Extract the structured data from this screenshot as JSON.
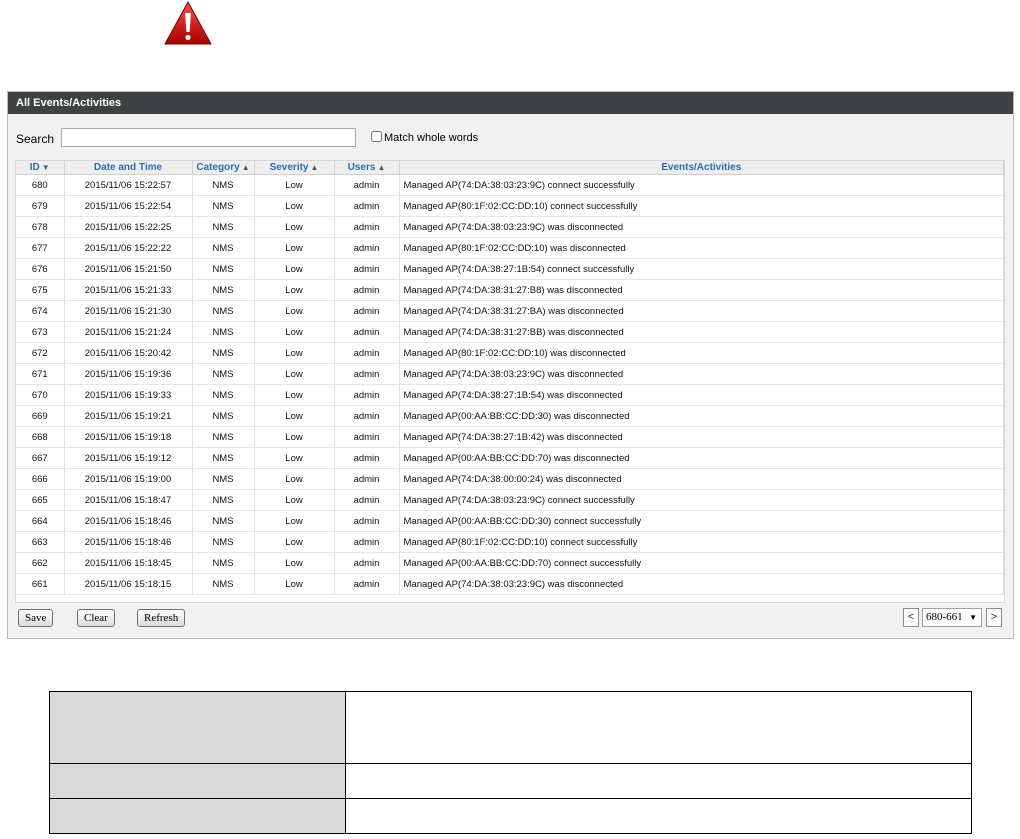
{
  "icons": {
    "warning": "warning-triangle-icon"
  },
  "colors": {
    "header_bg": "#3f4142",
    "link_blue": "#2a6db3",
    "warning_red": "#cc1111"
  },
  "panel": {
    "title": "All Events/Activities",
    "search_label": "Search",
    "search_value": "",
    "match_whole_words_label": "Match whole words",
    "match_whole_words_checked": false
  },
  "grid": {
    "columns": [
      {
        "label": "ID",
        "sort": "down"
      },
      {
        "label": "Date and Time",
        "sort": ""
      },
      {
        "label": "Category",
        "sort": "up"
      },
      {
        "label": "Severity",
        "sort": "up"
      },
      {
        "label": "Users",
        "sort": "up"
      },
      {
        "label": "Events/Activities",
        "sort": ""
      }
    ],
    "rows": [
      {
        "id": "680",
        "dt": "2015/11/06 15:22:57",
        "cat": "NMS",
        "sev": "Low",
        "user": "admin",
        "ev": "Managed AP(74:DA:38:03:23:9C) connect successfully"
      },
      {
        "id": "679",
        "dt": "2015/11/06 15:22:54",
        "cat": "NMS",
        "sev": "Low",
        "user": "admin",
        "ev": "Managed AP(80:1F:02:CC:DD:10) connect successfully"
      },
      {
        "id": "678",
        "dt": "2015/11/06 15:22:25",
        "cat": "NMS",
        "sev": "Low",
        "user": "admin",
        "ev": "Managed AP(74:DA:38:03:23:9C) was disconnected"
      },
      {
        "id": "677",
        "dt": "2015/11/06 15:22:22",
        "cat": "NMS",
        "sev": "Low",
        "user": "admin",
        "ev": "Managed AP(80:1F:02:CC:DD:10) was disconnected"
      },
      {
        "id": "676",
        "dt": "2015/11/06 15:21:50",
        "cat": "NMS",
        "sev": "Low",
        "user": "admin",
        "ev": "Managed AP(74:DA:38:27:1B:54) connect successfully"
      },
      {
        "id": "675",
        "dt": "2015/11/06 15:21:33",
        "cat": "NMS",
        "sev": "Low",
        "user": "admin",
        "ev": "Managed AP(74:DA:38:31:27:B8) was disconnected"
      },
      {
        "id": "674",
        "dt": "2015/11/06 15:21:30",
        "cat": "NMS",
        "sev": "Low",
        "user": "admin",
        "ev": "Managed AP(74:DA:38:31:27:BA) was disconnected"
      },
      {
        "id": "673",
        "dt": "2015/11/06 15:21:24",
        "cat": "NMS",
        "sev": "Low",
        "user": "admin",
        "ev": "Managed AP(74:DA:38:31:27:BB) was disconnected"
      },
      {
        "id": "672",
        "dt": "2015/11/06 15:20:42",
        "cat": "NMS",
        "sev": "Low",
        "user": "admin",
        "ev": "Managed AP(80:1F:02:CC:DD:10) was disconnected"
      },
      {
        "id": "671",
        "dt": "2015/11/06 15:19:36",
        "cat": "NMS",
        "sev": "Low",
        "user": "admin",
        "ev": "Managed AP(74:DA:38:03:23:9C) was disconnected"
      },
      {
        "id": "670",
        "dt": "2015/11/06 15:19:33",
        "cat": "NMS",
        "sev": "Low",
        "user": "admin",
        "ev": "Managed AP(74:DA:38:27:1B:54) was disconnected"
      },
      {
        "id": "669",
        "dt": "2015/11/06 15:19:21",
        "cat": "NMS",
        "sev": "Low",
        "user": "admin",
        "ev": "Managed AP(00:AA:BB:CC:DD:30) was disconnected"
      },
      {
        "id": "668",
        "dt": "2015/11/06 15:19:18",
        "cat": "NMS",
        "sev": "Low",
        "user": "admin",
        "ev": "Managed AP(74:DA:38:27:1B:42) was disconnected"
      },
      {
        "id": "667",
        "dt": "2015/11/06 15:19:12",
        "cat": "NMS",
        "sev": "Low",
        "user": "admin",
        "ev": "Managed AP(00:AA:BB:CC:DD:70) was disconnected"
      },
      {
        "id": "666",
        "dt": "2015/11/06 15:19:00",
        "cat": "NMS",
        "sev": "Low",
        "user": "admin",
        "ev": "Managed AP(74:DA:38:00:00:24) was disconnected"
      },
      {
        "id": "665",
        "dt": "2015/11/06 15:18:47",
        "cat": "NMS",
        "sev": "Low",
        "user": "admin",
        "ev": "Managed AP(74:DA:38:03:23:9C) connect successfully"
      },
      {
        "id": "664",
        "dt": "2015/11/06 15:18:46",
        "cat": "NMS",
        "sev": "Low",
        "user": "admin",
        "ev": "Managed AP(00:AA:BB:CC:DD:30) connect successfully"
      },
      {
        "id": "663",
        "dt": "2015/11/06 15:18:46",
        "cat": "NMS",
        "sev": "Low",
        "user": "admin",
        "ev": "Managed AP(80:1F:02:CC:DD:10) connect successfully"
      },
      {
        "id": "662",
        "dt": "2015/11/06 15:18:45",
        "cat": "NMS",
        "sev": "Low",
        "user": "admin",
        "ev": "Managed AP(00:AA:BB:CC:DD:70) connect successfully"
      },
      {
        "id": "661",
        "dt": "2015/11/06 15:18:15",
        "cat": "NMS",
        "sev": "Low",
        "user": "admin",
        "ev": "Managed AP(74:DA:38:03:23:9C) was disconnected"
      }
    ]
  },
  "footer": {
    "save_label": "Save",
    "clear_label": "Clear",
    "refresh_label": "Refresh",
    "prev_label": "<",
    "next_label": ">",
    "page_range": "680-661"
  }
}
